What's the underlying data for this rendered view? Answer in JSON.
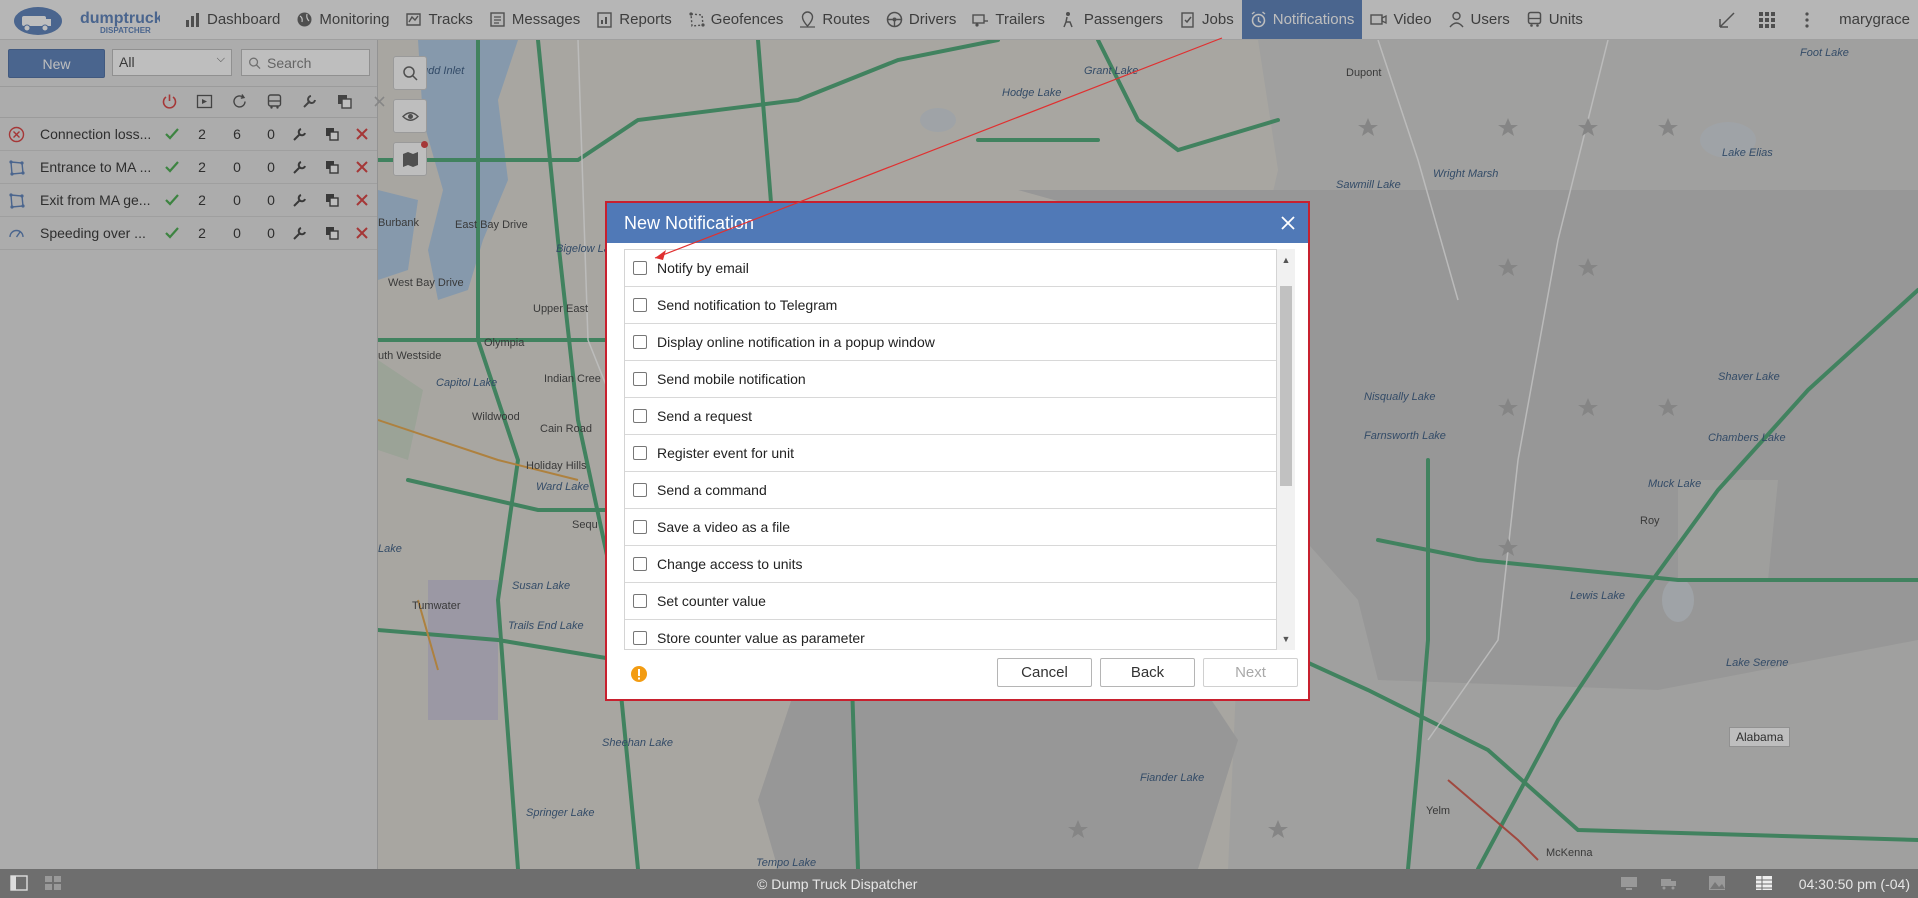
{
  "app": {
    "logo_text": "dumptruck",
    "logo_subtext": "DISPATCHER",
    "username": "marygrace"
  },
  "nav": {
    "items": [
      {
        "label": "Dashboard",
        "icon": "bar-chart-icon"
      },
      {
        "label": "Monitoring",
        "icon": "globe-icon"
      },
      {
        "label": "Tracks",
        "icon": "tracks-icon"
      },
      {
        "label": "Messages",
        "icon": "messages-icon"
      },
      {
        "label": "Reports",
        "icon": "report-icon"
      },
      {
        "label": "Geofences",
        "icon": "geofence-icon"
      },
      {
        "label": "Routes",
        "icon": "route-pin-icon"
      },
      {
        "label": "Drivers",
        "icon": "steering-wheel-icon"
      },
      {
        "label": "Trailers",
        "icon": "trailer-icon"
      },
      {
        "label": "Passengers",
        "icon": "passenger-icon"
      },
      {
        "label": "Jobs",
        "icon": "job-clipboard-icon"
      },
      {
        "label": "Notifications",
        "icon": "alarm-clock-icon",
        "active": true
      },
      {
        "label": "Video",
        "icon": "video-camera-icon"
      },
      {
        "label": "Users",
        "icon": "user-icon"
      },
      {
        "label": "Units",
        "icon": "bus-icon"
      }
    ]
  },
  "left_panel": {
    "new_label": "New",
    "filter_value": "All",
    "search_placeholder": "Search",
    "notifications": [
      {
        "name": "Connection loss...",
        "type_icon": "connection-loss-icon",
        "c1": "2",
        "c2": "6",
        "c3": "0"
      },
      {
        "name": "Entrance to MA ...",
        "type_icon": "geofence-enter-icon",
        "c1": "2",
        "c2": "0",
        "c3": "0"
      },
      {
        "name": "Exit from MA ge...",
        "type_icon": "geofence-exit-icon",
        "c1": "2",
        "c2": "0",
        "c3": "0"
      },
      {
        "name": "Speeding over ...",
        "type_icon": "speedometer-icon",
        "c1": "2",
        "c2": "0",
        "c3": "0"
      }
    ]
  },
  "map": {
    "place_labels": [
      "udd Inlet",
      "Hodge Lake",
      "Grant Lake",
      "Dupont",
      "Foot Lake",
      "Burbank",
      "East Bay Drive",
      "Sawmill Lake",
      "Wright Marsh",
      "Lake Elias",
      "Bigelow Lake",
      "West Bay Drive",
      "Upper East",
      "Olympia",
      "uth Westside",
      "Capitol Lake",
      "Indian Cree",
      "Wildwood",
      "Cain Road",
      "Holiday Hills",
      "Ward Lake",
      "Sequ",
      "Lake",
      "Nisqually Lake",
      "Farnsworth Lake",
      "Shaver Lake",
      "Chambers Lake",
      "Muck Lake",
      "Roy",
      "Lewis Lake",
      "Susan Lake",
      "Tumwater",
      "Trails End Lake",
      "Lake Serene",
      "Sheehan Lake",
      "Fiander Lake",
      "Springer Lake",
      "Yelm",
      "McKenna",
      "Tempo Lake"
    ],
    "tooltip": "Alabama"
  },
  "modal": {
    "title": "New Notification",
    "options": [
      "Notify by email",
      "Send notification to Telegram",
      "Display online notification in a popup window",
      "Send mobile notification",
      "Send a request",
      "Register event for unit",
      "Send a command",
      "Save a video as a file",
      "Change access to units",
      "Set counter value",
      "Store counter value as parameter"
    ],
    "cancel_label": "Cancel",
    "back_label": "Back",
    "next_label": "Next"
  },
  "statusbar": {
    "copyright": "© Dump Truck Dispatcher",
    "time": "04:30:50 pm (-04)"
  },
  "colors": {
    "accent": "#4e77b5",
    "modal_border": "#c8202e",
    "check_green": "#3aa640",
    "delete_red": "#d93030",
    "warning_orange": "#f39c12"
  }
}
